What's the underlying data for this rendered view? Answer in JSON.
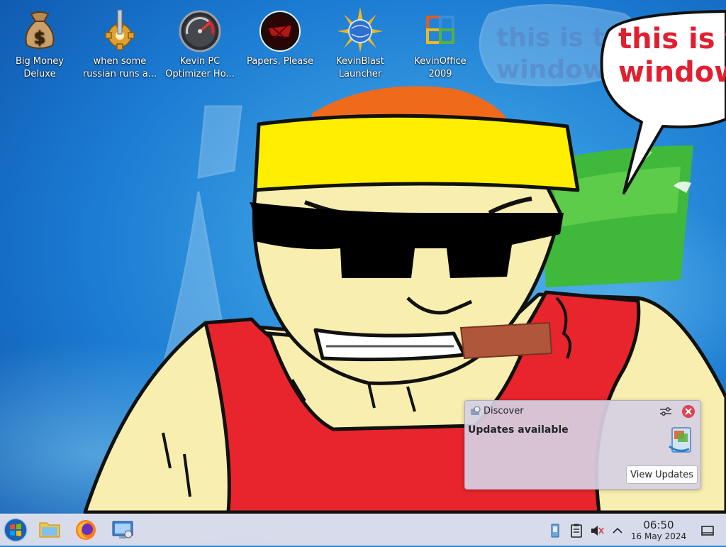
{
  "desktop": {
    "icons": [
      {
        "label": "Big Money\nDeluxe",
        "icon": "money-bag-icon"
      },
      {
        "label": "when some\nrussian runs a...",
        "icon": "gear-icon"
      },
      {
        "label": "Kevin PC\nOptimizer Ho...",
        "icon": "speedometer-icon"
      },
      {
        "label": "Papers, Please",
        "icon": "papers-please-icon"
      },
      {
        "label": "KevinBlast\nLauncher",
        "icon": "sunburst-globe-icon"
      },
      {
        "label": "KevinOffice\n2009",
        "icon": "office-logo-icon"
      }
    ],
    "wallpaper": {
      "speech_bubble_text": [
        "this is t",
        "window"
      ],
      "faint_bubble_text": [
        "this is to",
        "windows"
      ]
    }
  },
  "notification": {
    "app_name": "Discover",
    "summary": "Updates available",
    "action_label": "View Updates",
    "icons": {
      "app": "discover-icon",
      "configure": "configure-icon",
      "close": "close-icon",
      "image": "update-package-icon"
    }
  },
  "taskbar": {
    "launchers": [
      "start-menu-icon",
      "file-manager-icon",
      "firefox-icon",
      "system-settings-icon"
    ],
    "tray": [
      "clipboard-update-icon",
      "clipboard-icon",
      "volume-muted-icon",
      "expand-tray-arrow-icon"
    ],
    "clock": {
      "time": "06:50",
      "date": "16 May 2024"
    },
    "show_desktop": "show-desktop-icon"
  },
  "colors": {
    "close_red": "#da4453",
    "bubble_text_red": "#e02030",
    "hat_yellow": "#ffee00",
    "shirt_red": "#e8242c",
    "skin": "#f7eeb0"
  }
}
